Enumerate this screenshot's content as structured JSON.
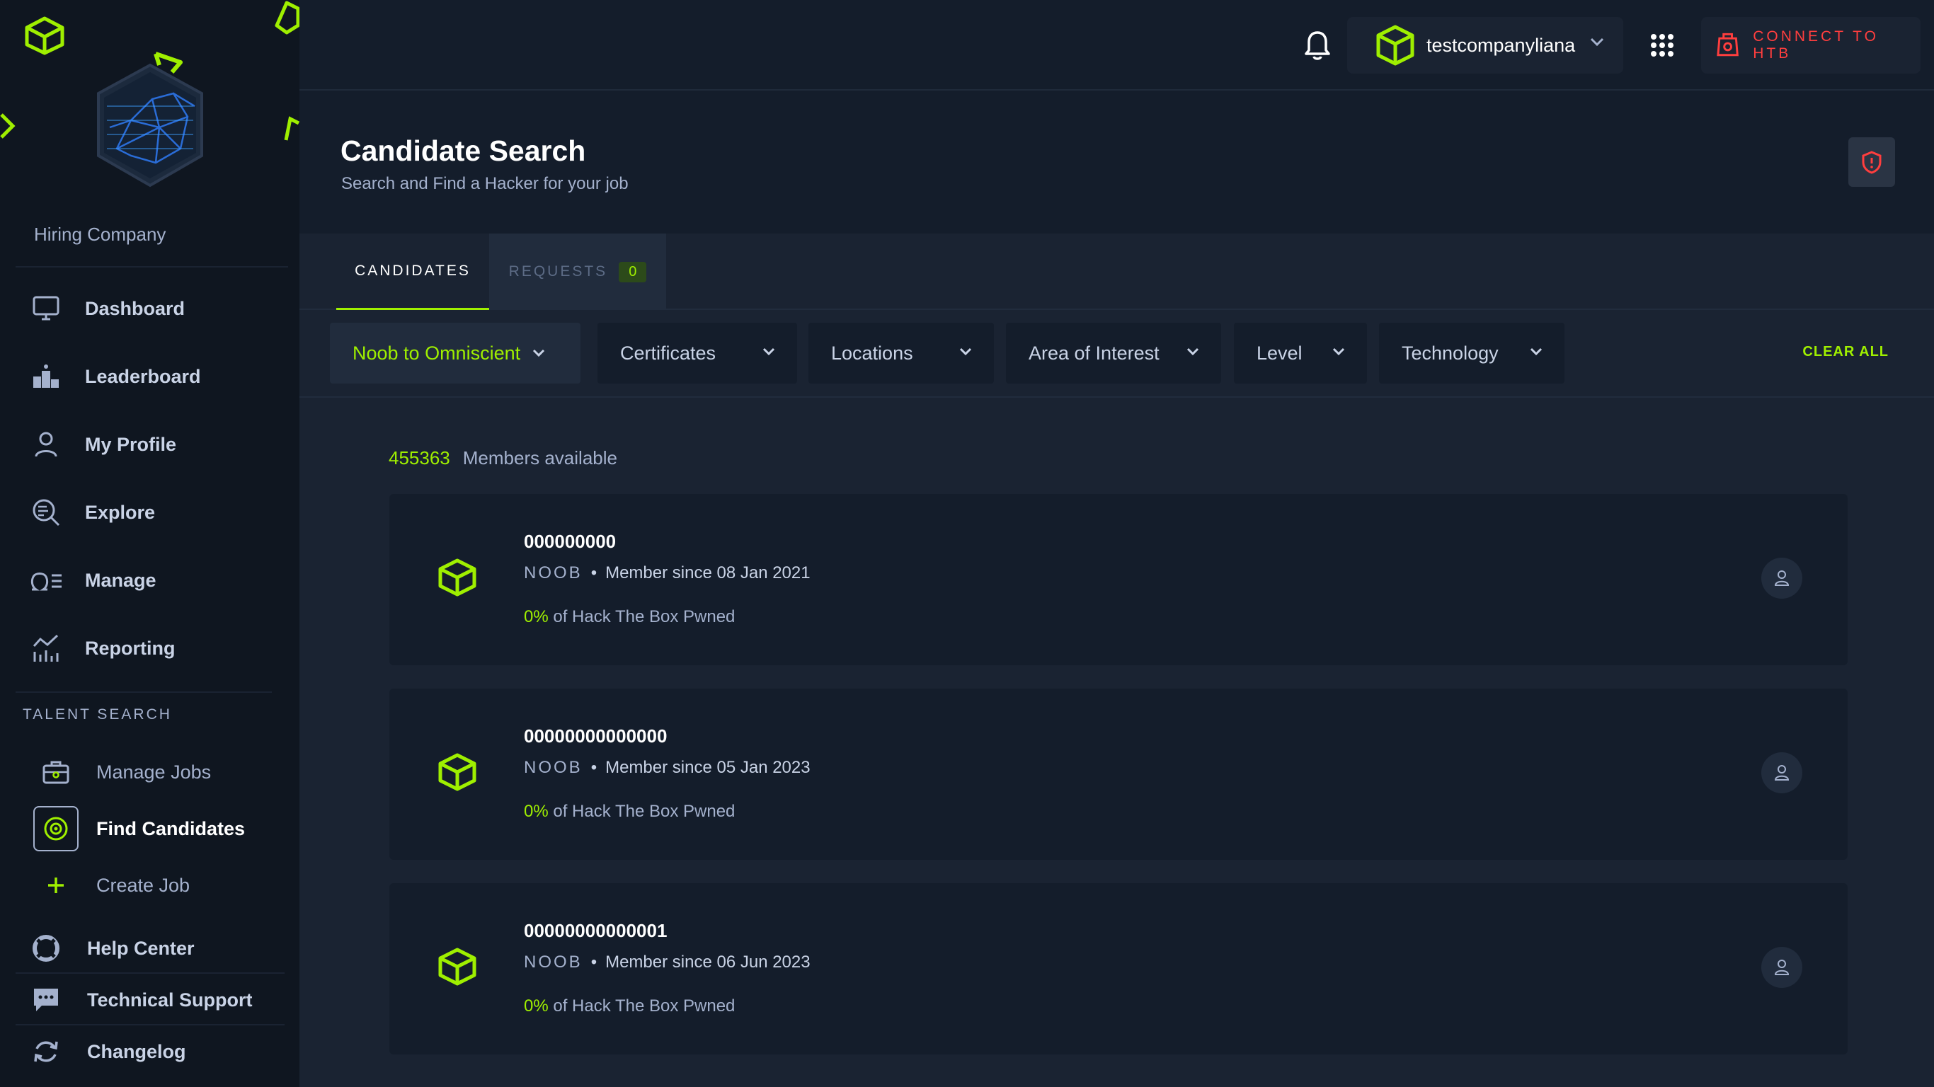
{
  "sidebar": {
    "company_label": "Hiring Company",
    "nav": [
      {
        "label": "Dashboard",
        "icon": "monitor-icon"
      },
      {
        "label": "Leaderboard",
        "icon": "podium-icon"
      },
      {
        "label": "My Profile",
        "icon": "user-icon"
      },
      {
        "label": "Explore",
        "icon": "search-list-icon"
      },
      {
        "label": "Manage",
        "icon": "omega-list-icon"
      },
      {
        "label": "Reporting",
        "icon": "chart-icon"
      }
    ],
    "section_label": "TALENT SEARCH",
    "sub": [
      {
        "label": "Manage Jobs",
        "icon": "briefcase-icon"
      },
      {
        "label": "Find Candidates",
        "icon": "target-icon"
      },
      {
        "label": "Create Job",
        "icon": "plus-icon"
      }
    ],
    "footer": [
      {
        "label": "Help Center",
        "icon": "lifebuoy-icon"
      },
      {
        "label": "Technical Support",
        "icon": "chat-icon"
      },
      {
        "label": "Changelog",
        "icon": "refresh-icon"
      }
    ]
  },
  "topbar": {
    "username": "testcompanyliana",
    "connect_label": "CONNECT TO HTB"
  },
  "header": {
    "title": "Candidate Search",
    "subtitle": "Search and Find a Hacker for your job"
  },
  "tabs": {
    "candidates": "CANDIDATES",
    "requests": "REQUESTS",
    "requests_count": "0"
  },
  "filters": {
    "rank_range": "Noob to Omniscient",
    "certificates": "Certificates",
    "locations": "Locations",
    "area_of_interest": "Area of Interest",
    "level": "Level",
    "technology": "Technology",
    "clear_all": "CLEAR ALL"
  },
  "results": {
    "count": "455363",
    "count_label": "Members available",
    "candidates": [
      {
        "name": "000000000",
        "rank": "NOOB",
        "since": "Member since 08 Jan 2021",
        "pct": "0%",
        "progress_text": "of Hack The Box Pwned"
      },
      {
        "name": "00000000000000",
        "rank": "NOOB",
        "since": "Member since 05 Jan 2023",
        "pct": "0%",
        "progress_text": "of Hack The Box Pwned"
      },
      {
        "name": "00000000000001",
        "rank": "NOOB",
        "since": "Member since 06 Jun 2023",
        "pct": "0%",
        "progress_text": "of Hack The Box Pwned"
      }
    ]
  },
  "colors": {
    "accent": "#9fef00",
    "danger": "#ff3e3e",
    "bg": "#141d2b",
    "panel": "#1a2332"
  }
}
